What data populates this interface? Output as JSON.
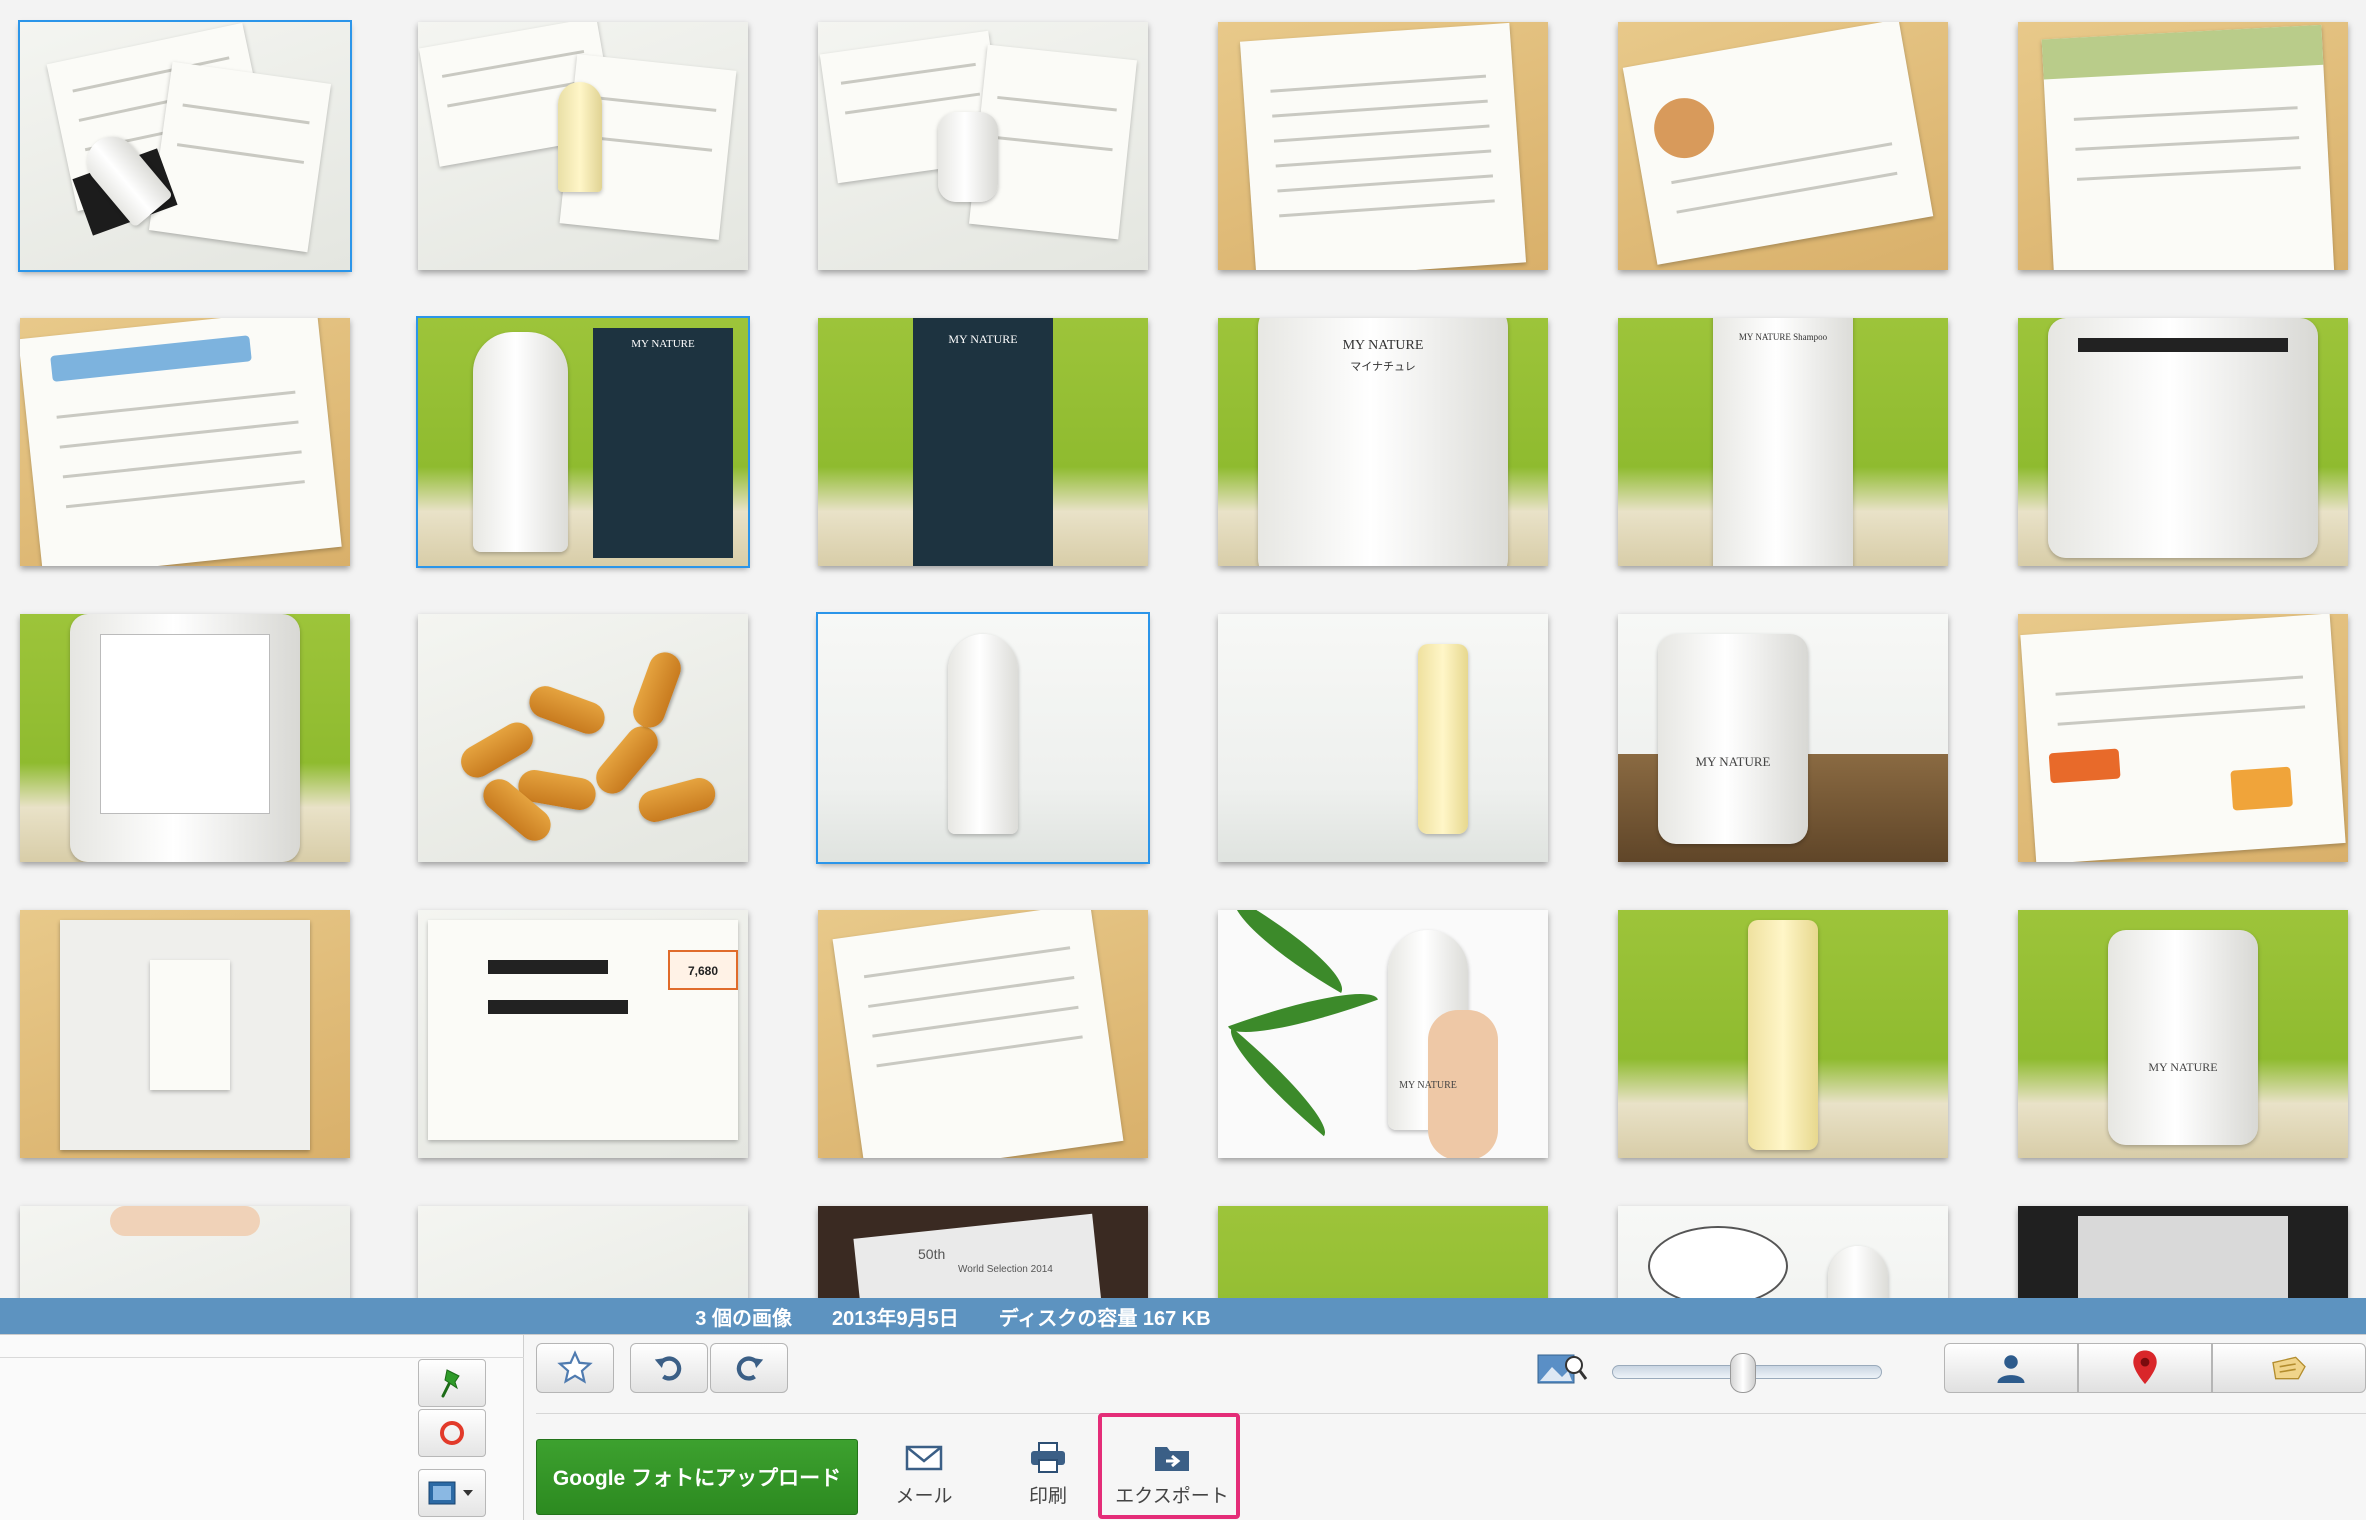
{
  "info_bar": {
    "count": "3 個の画像",
    "date": "2013年9月5日",
    "size": "ディスクの容量 167 KB"
  },
  "toolbar": {
    "upload_label": "Google フォトにアップロード",
    "mail_label": "メール",
    "print_label": "印刷",
    "export_label": "エクスポート"
  },
  "thumbs": {
    "r1c1": {
      "selected": true
    },
    "r2c2": {
      "selected": true
    },
    "r3c3": {
      "selected": true
    },
    "r2c3_text": "MY NATURE",
    "r2c4_text": "MY NATURE",
    "r2c4_sub": "マイナチュレ",
    "r2c5_text": "MY NATURE Shampoo",
    "r3c5_text": "MY NATURE",
    "r4c5_text": "MY NATURE",
    "r4c6_text": "MY NATURE",
    "r4c2_price": "7,680",
    "r5c3_badge": "50th",
    "r5c3_caption": "World Selection 2014"
  },
  "colors": {
    "selection": "#2b95e9",
    "info_bar": "#5d93c0",
    "upload": "#2c8a20",
    "export_highlight": "#e42d78"
  }
}
